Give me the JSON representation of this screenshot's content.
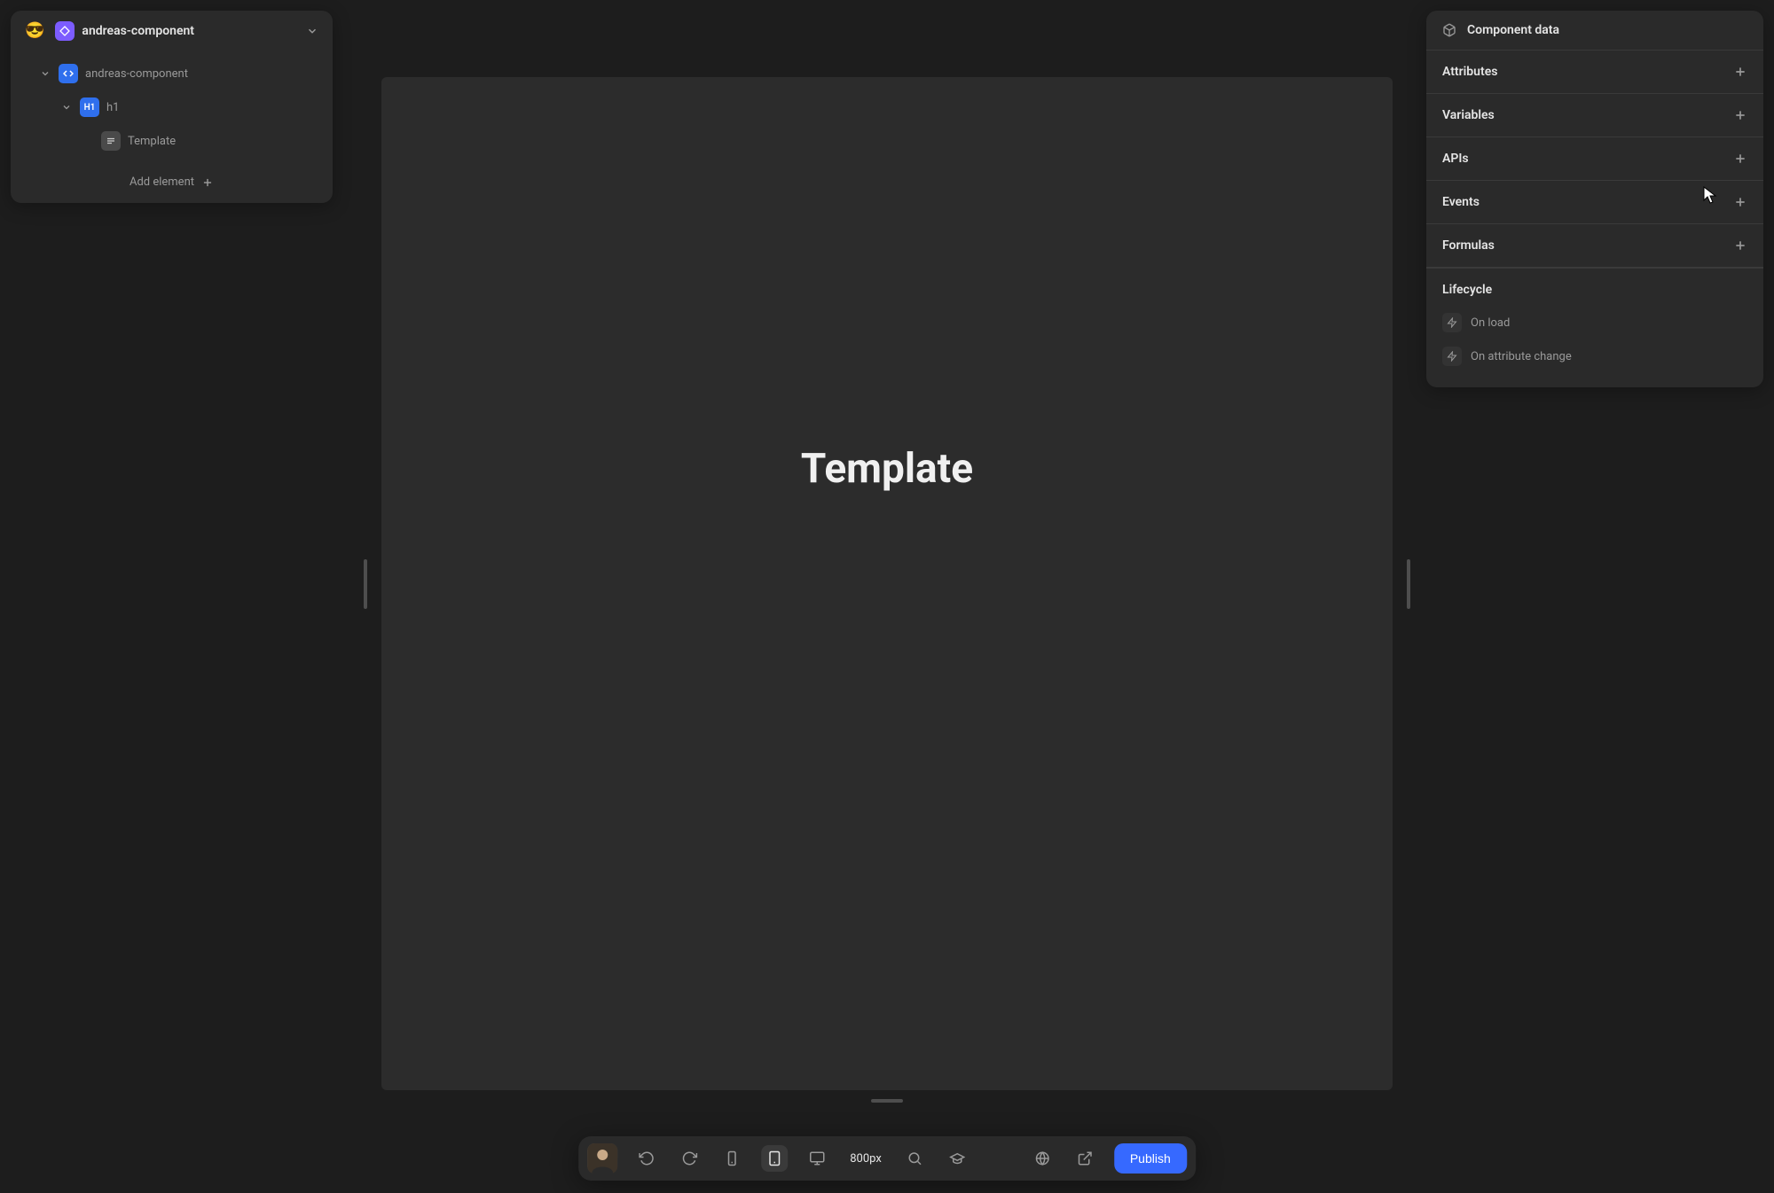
{
  "project": {
    "emoji": "😎",
    "component_name": "andreas-component"
  },
  "tree": {
    "root": {
      "label": "andreas-component"
    },
    "h1": {
      "label": "h1",
      "badge": "H1"
    },
    "tmpl": {
      "label": "Template"
    }
  },
  "add_element_label": "Add element",
  "canvas": {
    "heading": "Template"
  },
  "right": {
    "title": "Component data",
    "sections": {
      "attributes": "Attributes",
      "variables": "Variables",
      "apis": "APIs",
      "events": "Events",
      "formulas": "Formulas"
    },
    "lifecycle": {
      "title": "Lifecycle",
      "on_load": "On load",
      "on_attr_change": "On attribute change"
    }
  },
  "bottom": {
    "viewport": "800px",
    "publish": "Publish"
  }
}
